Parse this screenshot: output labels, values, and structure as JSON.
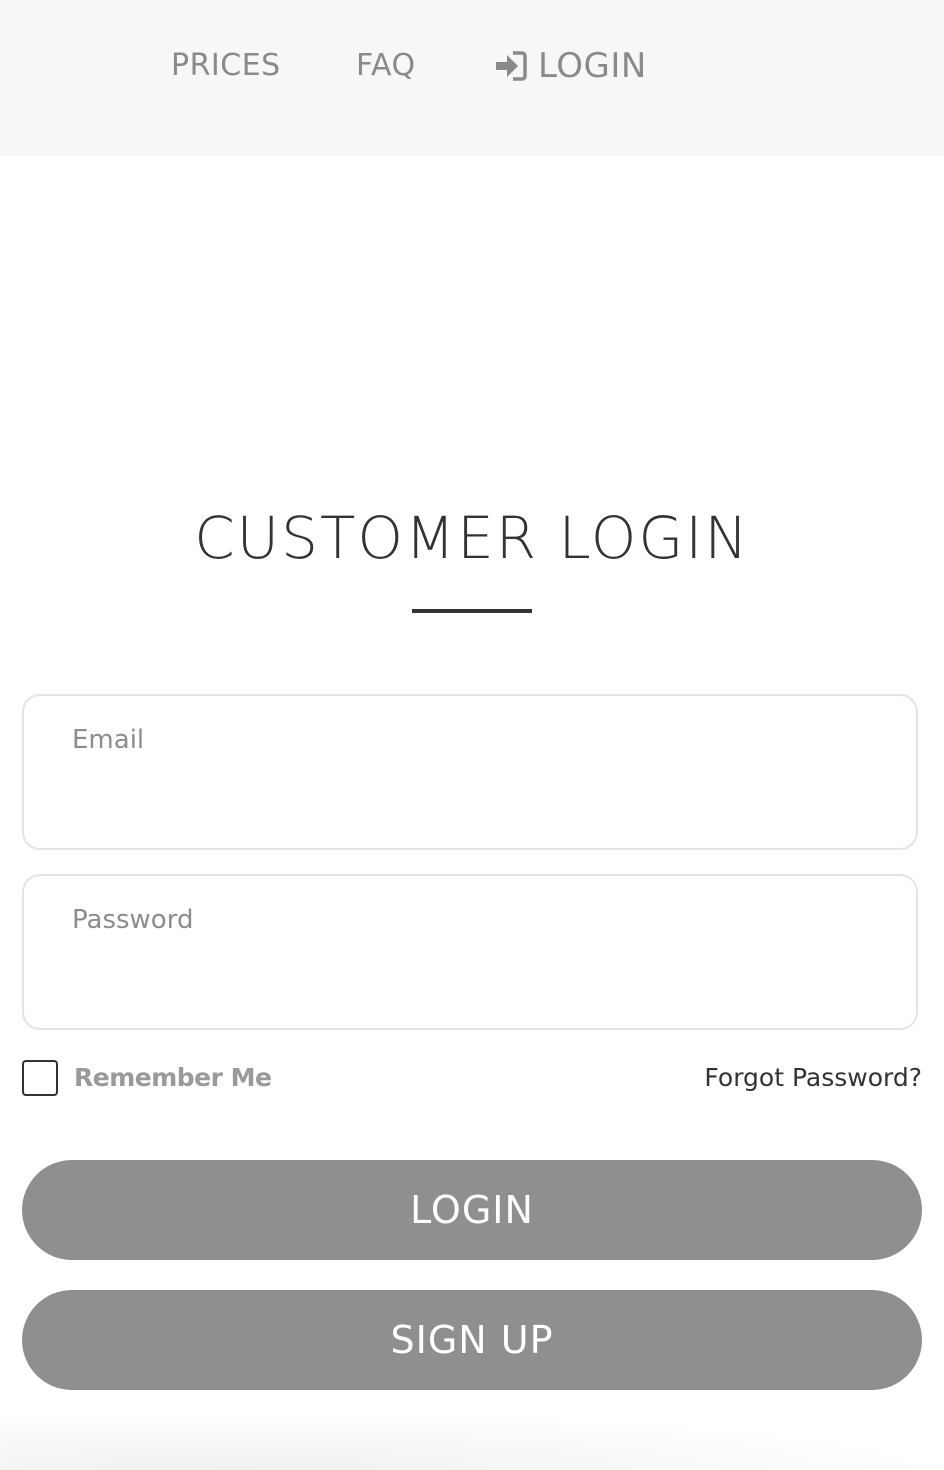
{
  "nav": {
    "prices": "PRICES",
    "faq": "FAQ",
    "login": "LOGIN",
    "login_icon": "sign-in-icon"
  },
  "page": {
    "title": "CUSTOMER LOGIN"
  },
  "form": {
    "email": {
      "placeholder": "Email",
      "value": ""
    },
    "password": {
      "placeholder": "Password",
      "value": ""
    },
    "remember_me": {
      "label": "Remember Me",
      "checked": false
    },
    "forgot_password": "Forgot Password?",
    "login_button": "LOGIN",
    "signup_button": "SIGN UP"
  },
  "colors": {
    "topbar_bg": "#f6f7f9",
    "nav_text": "#8a8a8a",
    "title_text": "#333333",
    "button_bg": "#8f8f8f",
    "button_text": "#ffffff",
    "field_border": "#e4e4e4"
  }
}
